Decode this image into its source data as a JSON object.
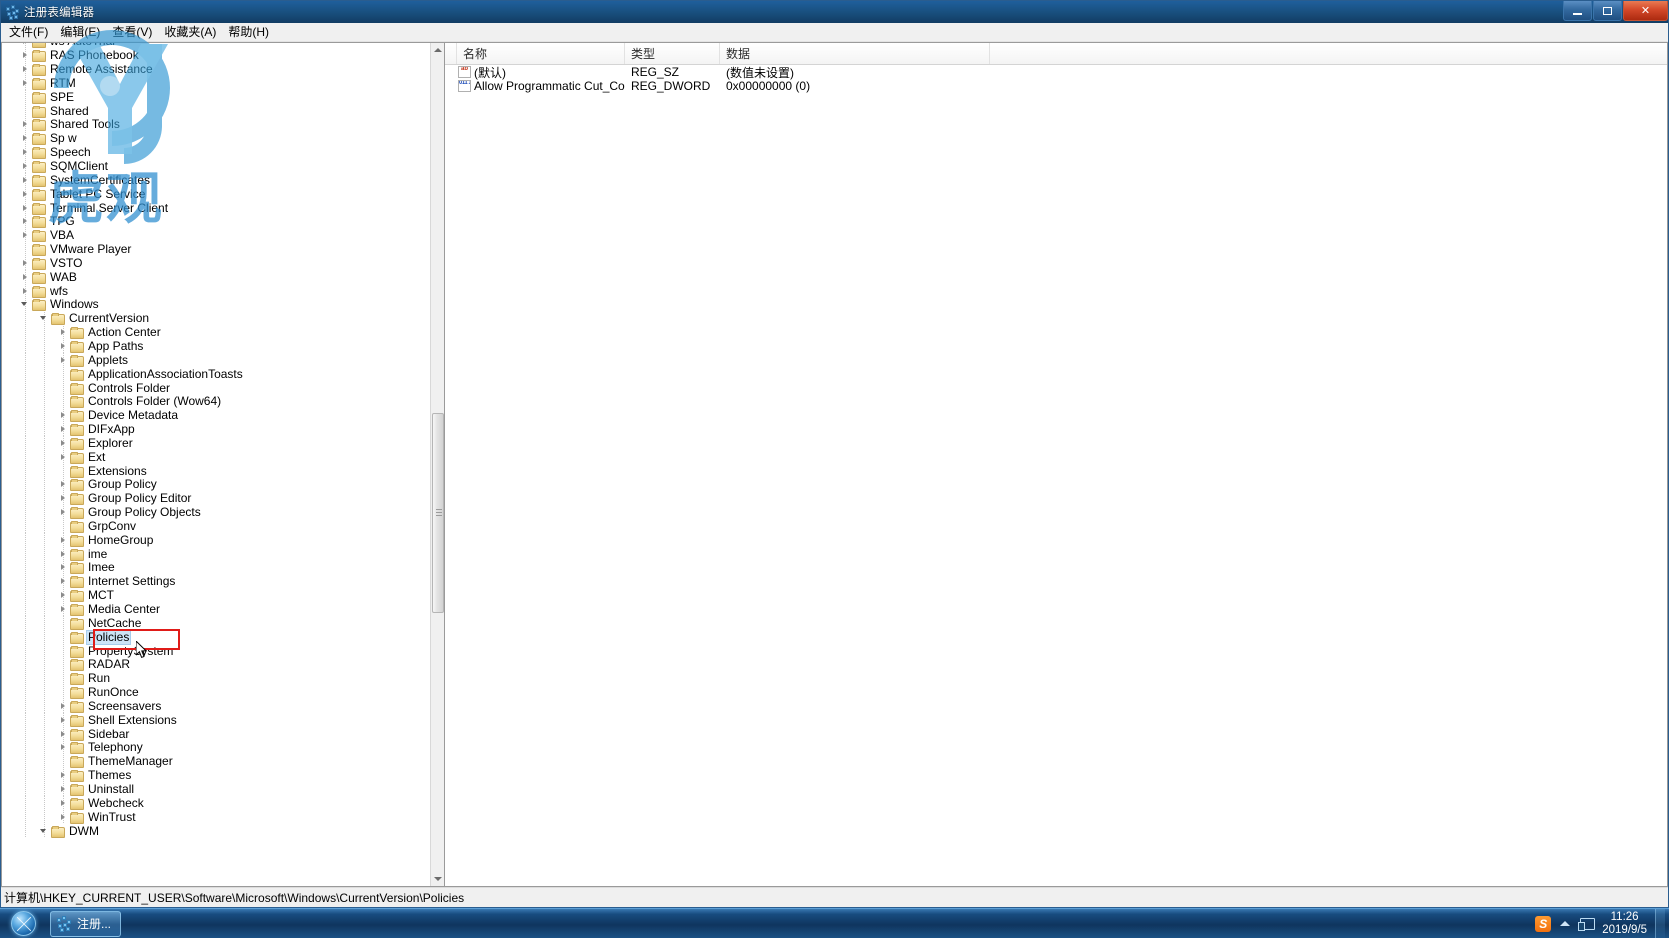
{
  "window": {
    "title": "注册表编辑器",
    "icon": "registry-icon",
    "buttons": {
      "minimize": "–",
      "maximize": "□",
      "close": "✕"
    }
  },
  "menu": {
    "items": [
      {
        "label": "文件(F)"
      },
      {
        "label": "编辑(E)"
      },
      {
        "label": "查看(V)"
      },
      {
        "label": "收藏夹(A)"
      },
      {
        "label": "帮助(H)"
      }
    ]
  },
  "tree": {
    "nodes": [
      {
        "label": "ws AutoTrial",
        "indent": 1,
        "twist": "collapsed",
        "selected": false,
        "obscured": true
      },
      {
        "label": "RAS Phonebook",
        "indent": 1,
        "twist": "collapsed",
        "selected": false,
        "obscured": true
      },
      {
        "label": "Remote Assistance",
        "indent": 1,
        "twist": "collapsed",
        "selected": false,
        "obscured": true
      },
      {
        "label": "RTM",
        "indent": 1,
        "twist": "collapsed",
        "selected": false,
        "obscured": true
      },
      {
        "label": "SPE",
        "indent": 1,
        "twist": "none",
        "selected": false,
        "obscured": true
      },
      {
        "label": "Shared",
        "indent": 1,
        "twist": "none",
        "selected": false,
        "obscured": true
      },
      {
        "label": "Shared Tools",
        "indent": 1,
        "twist": "collapsed",
        "selected": false,
        "obscured": true
      },
      {
        "label": "Sp w",
        "indent": 1,
        "twist": "collapsed",
        "selected": false,
        "obscured": true
      },
      {
        "label": "Speech",
        "indent": 1,
        "twist": "collapsed",
        "selected": false,
        "obscured": true
      },
      {
        "label": "SQMClient",
        "indent": 1,
        "twist": "collapsed",
        "selected": false,
        "obscured": true
      },
      {
        "label": "SystemCertificates",
        "indent": 1,
        "twist": "collapsed",
        "selected": false,
        "obscured": true
      },
      {
        "label": "Tablet PC Service",
        "indent": 1,
        "twist": "collapsed",
        "selected": false,
        "obscured": true
      },
      {
        "label": "Terminal Server Client",
        "indent": 1,
        "twist": "collapsed",
        "selected": false
      },
      {
        "label": "TPG",
        "indent": 1,
        "twist": "collapsed",
        "selected": false
      },
      {
        "label": "VBA",
        "indent": 1,
        "twist": "collapsed",
        "selected": false
      },
      {
        "label": "VMware Player",
        "indent": 1,
        "twist": "none",
        "selected": false
      },
      {
        "label": "VSTO",
        "indent": 1,
        "twist": "collapsed",
        "selected": false
      },
      {
        "label": "WAB",
        "indent": 1,
        "twist": "collapsed",
        "selected": false
      },
      {
        "label": "wfs",
        "indent": 1,
        "twist": "collapsed",
        "selected": false
      },
      {
        "label": "Windows",
        "indent": 1,
        "twist": "expanded",
        "selected": false
      },
      {
        "label": "CurrentVersion",
        "indent": 2,
        "twist": "expanded",
        "selected": false
      },
      {
        "label": "Action Center",
        "indent": 3,
        "twist": "collapsed",
        "selected": false
      },
      {
        "label": "App Paths",
        "indent": 3,
        "twist": "collapsed",
        "selected": false
      },
      {
        "label": "Applets",
        "indent": 3,
        "twist": "collapsed",
        "selected": false
      },
      {
        "label": "ApplicationAssociationToasts",
        "indent": 3,
        "twist": "none",
        "selected": false
      },
      {
        "label": "Controls Folder",
        "indent": 3,
        "twist": "none",
        "selected": false
      },
      {
        "label": "Controls Folder (Wow64)",
        "indent": 3,
        "twist": "none",
        "selected": false
      },
      {
        "label": "Device Metadata",
        "indent": 3,
        "twist": "collapsed",
        "selected": false
      },
      {
        "label": "DIFxApp",
        "indent": 3,
        "twist": "collapsed",
        "selected": false
      },
      {
        "label": "Explorer",
        "indent": 3,
        "twist": "collapsed",
        "selected": false
      },
      {
        "label": "Ext",
        "indent": 3,
        "twist": "collapsed",
        "selected": false
      },
      {
        "label": "Extensions",
        "indent": 3,
        "twist": "none",
        "selected": false
      },
      {
        "label": "Group Policy",
        "indent": 3,
        "twist": "collapsed",
        "selected": false
      },
      {
        "label": "Group Policy Editor",
        "indent": 3,
        "twist": "collapsed",
        "selected": false
      },
      {
        "label": "Group Policy Objects",
        "indent": 3,
        "twist": "collapsed",
        "selected": false
      },
      {
        "label": "GrpConv",
        "indent": 3,
        "twist": "none",
        "selected": false
      },
      {
        "label": "HomeGroup",
        "indent": 3,
        "twist": "collapsed",
        "selected": false
      },
      {
        "label": "ime",
        "indent": 3,
        "twist": "collapsed",
        "selected": false
      },
      {
        "label": "Imee",
        "indent": 3,
        "twist": "collapsed",
        "selected": false
      },
      {
        "label": "Internet Settings",
        "indent": 3,
        "twist": "collapsed",
        "selected": false
      },
      {
        "label": "MCT",
        "indent": 3,
        "twist": "collapsed",
        "selected": false
      },
      {
        "label": "Media Center",
        "indent": 3,
        "twist": "collapsed",
        "selected": false
      },
      {
        "label": "NetCache",
        "indent": 3,
        "twist": "none",
        "selected": false
      },
      {
        "label": "Policies",
        "indent": 3,
        "twist": "none",
        "selected": true
      },
      {
        "label": "PropertySystem",
        "indent": 3,
        "twist": "none",
        "selected": false
      },
      {
        "label": "RADAR",
        "indent": 3,
        "twist": "none",
        "selected": false
      },
      {
        "label": "Run",
        "indent": 3,
        "twist": "none",
        "selected": false
      },
      {
        "label": "RunOnce",
        "indent": 3,
        "twist": "none",
        "selected": false
      },
      {
        "label": "Screensavers",
        "indent": 3,
        "twist": "collapsed",
        "selected": false
      },
      {
        "label": "Shell Extensions",
        "indent": 3,
        "twist": "collapsed",
        "selected": false
      },
      {
        "label": "Sidebar",
        "indent": 3,
        "twist": "collapsed",
        "selected": false
      },
      {
        "label": "Telephony",
        "indent": 3,
        "twist": "collapsed",
        "selected": false
      },
      {
        "label": "ThemeManager",
        "indent": 3,
        "twist": "none",
        "selected": false
      },
      {
        "label": "Themes",
        "indent": 3,
        "twist": "collapsed",
        "selected": false
      },
      {
        "label": "Uninstall",
        "indent": 3,
        "twist": "collapsed",
        "selected": false
      },
      {
        "label": "Webcheck",
        "indent": 3,
        "twist": "collapsed",
        "selected": false
      },
      {
        "label": "WinTrust",
        "indent": 3,
        "twist": "collapsed",
        "selected": false
      },
      {
        "label": "DWM",
        "indent": 2,
        "twist": "expanded",
        "selected": false
      }
    ]
  },
  "list": {
    "columns": [
      "名称",
      "类型",
      "数据"
    ],
    "rows": [
      {
        "name": "(默认)",
        "type": "REG_SZ",
        "data": "(数值未设置)",
        "icon": "string-value-icon"
      },
      {
        "name": "Allow Programmatic Cut_Co...",
        "type": "REG_DWORD",
        "data": "0x00000000 (0)",
        "icon": "dword-value-icon"
      }
    ]
  },
  "statusbar": {
    "path": "计算机\\HKEY_CURRENT_USER\\Software\\Microsoft\\Windows\\CurrentVersion\\Policies"
  },
  "watermark": {
    "text": "虎观"
  },
  "taskbar": {
    "start": "start-orb",
    "buttons": [
      {
        "label": "注册..."
      }
    ],
    "tray": {
      "sogou": "S",
      "time": "11:26",
      "date": "2019/9/5"
    }
  },
  "colors": {
    "accent": "#1d5b8f",
    "selection": "#cce4f7",
    "annotation": "#e01b18",
    "close_button": "#d4492a",
    "folder": "#f3dd9a"
  }
}
